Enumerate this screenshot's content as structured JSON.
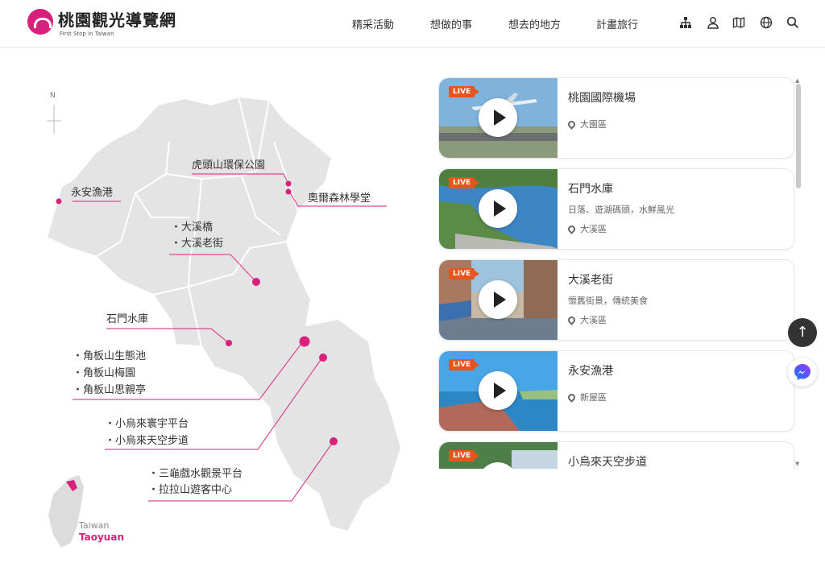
{
  "header": {
    "site_title": "桃園觀光導覽網",
    "site_subtitle": "First Stop in Taiwan",
    "nav": [
      "精采活動",
      "想做的事",
      "想去的地方",
      "計畫旅行"
    ],
    "icons": [
      "sitemap-icon",
      "user-icon",
      "map-icon",
      "globe-icon",
      "search-icon"
    ]
  },
  "map": {
    "compass_label": "N",
    "taiwan_label": "Taiwan",
    "taoyuan_label": "Taoyuan",
    "accent_color": "#d8207d",
    "spots": [
      {
        "id": "yongan",
        "lines": [
          "永安漁港"
        ]
      },
      {
        "id": "hutoushan",
        "lines": [
          "虎頭山環保公園"
        ]
      },
      {
        "id": "aoer",
        "lines": [
          "奧爾森林學堂"
        ]
      },
      {
        "id": "daxi",
        "lines": [
          "・大溪橋",
          "・大溪老街"
        ]
      },
      {
        "id": "shimen",
        "lines": [
          "石門水庫"
        ]
      },
      {
        "id": "jiaobanshan",
        "lines": [
          "・角板山生態池",
          "・角板山梅園",
          "・角板山思親亭"
        ]
      },
      {
        "id": "xiaowulai",
        "lines": [
          "・小烏來寰宇平台",
          "・小烏來天空步道"
        ]
      },
      {
        "id": "sanguixi",
        "lines": [
          "・三龜戲水觀景平台",
          "・拉拉山遊客中心"
        ]
      }
    ]
  },
  "live_list": {
    "live_badge": "LIVE",
    "items": [
      {
        "title": "桃園國際機場",
        "desc": "",
        "location": "大園區"
      },
      {
        "title": "石門水庫",
        "desc": "日落、遊湖碼頭，水鮮風光",
        "location": "大溪區"
      },
      {
        "title": "大溪老街",
        "desc": "懷舊街景，傳統美食",
        "location": "大溪區"
      },
      {
        "title": "永安漁港",
        "desc": "",
        "location": "新屋區"
      },
      {
        "title": "小烏來天空步道",
        "desc": "",
        "location": ""
      }
    ]
  },
  "colors": {
    "accent": "#d8207d",
    "live": "#e8541c",
    "map_fill": "#e4e4e4"
  }
}
